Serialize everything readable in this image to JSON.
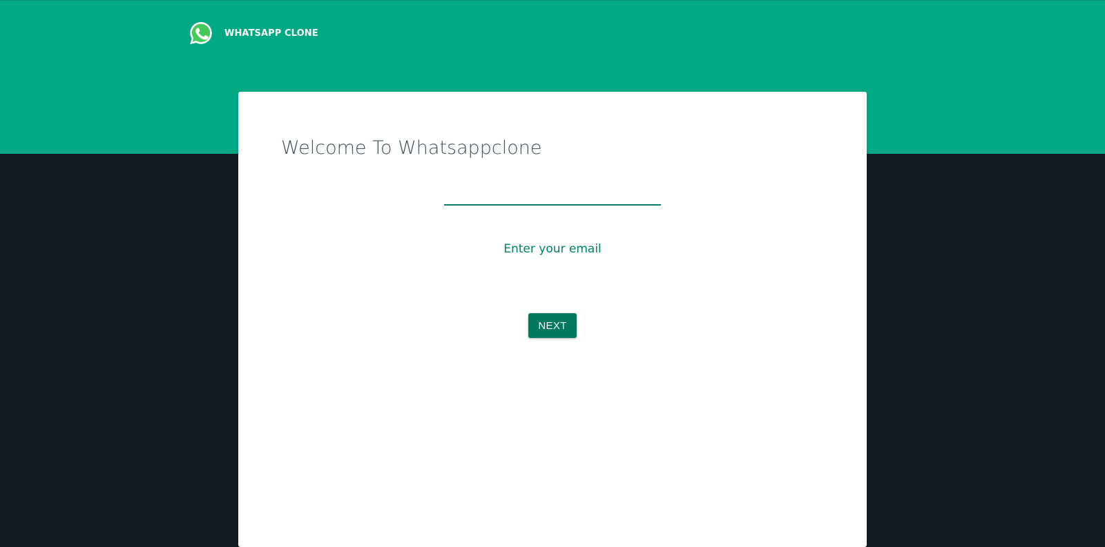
{
  "app": {
    "brand_name": "WHATSAPP CLONE",
    "logo_icon": "whatsapp-logo-icon"
  },
  "login": {
    "welcome_title": "Welcome To Whatsappclone",
    "email_label": "Enter your email",
    "email_value": "",
    "next_label": "NEXT"
  },
  "colors": {
    "brand_green": "#00a884",
    "dark_background": "#111921",
    "accent_teal": "#008069",
    "button_teal": "#00775f"
  }
}
